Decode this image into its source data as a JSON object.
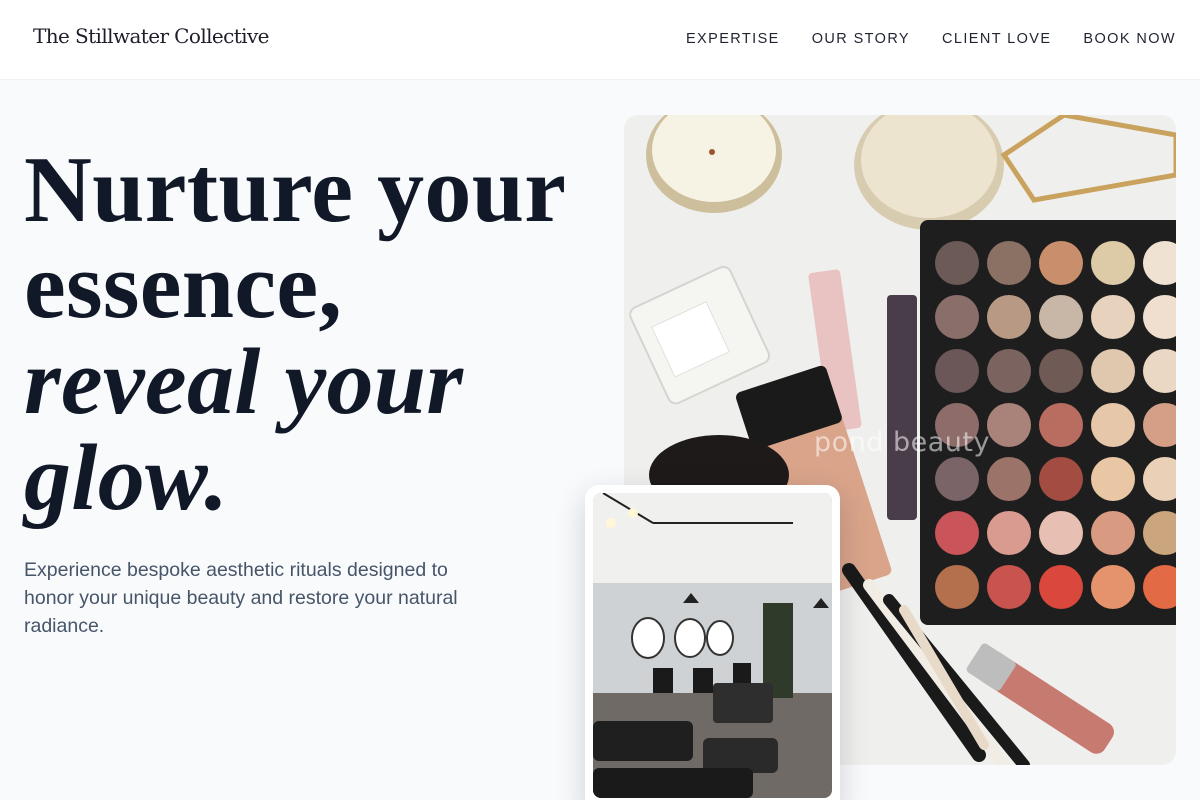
{
  "header": {
    "brand": "The Stillwater Collective",
    "nav": [
      {
        "label": "EXPERTISE"
      },
      {
        "label": "OUR STORY"
      },
      {
        "label": "CLIENT LOVE"
      },
      {
        "label": "BOOK NOW"
      }
    ]
  },
  "hero": {
    "title_line1": "Nurture your",
    "title_line2": "essence,",
    "title_line3": "reveal your",
    "title_line4": "glow.",
    "subtext": "Experience bespoke aesthetic rituals designed to honor your unique beauty and restore your natural radiance."
  },
  "images": {
    "main_watermark": "pond beauty"
  },
  "colors": {
    "background": "#f8fafc",
    "title": "#111827",
    "subtext": "#475569"
  }
}
